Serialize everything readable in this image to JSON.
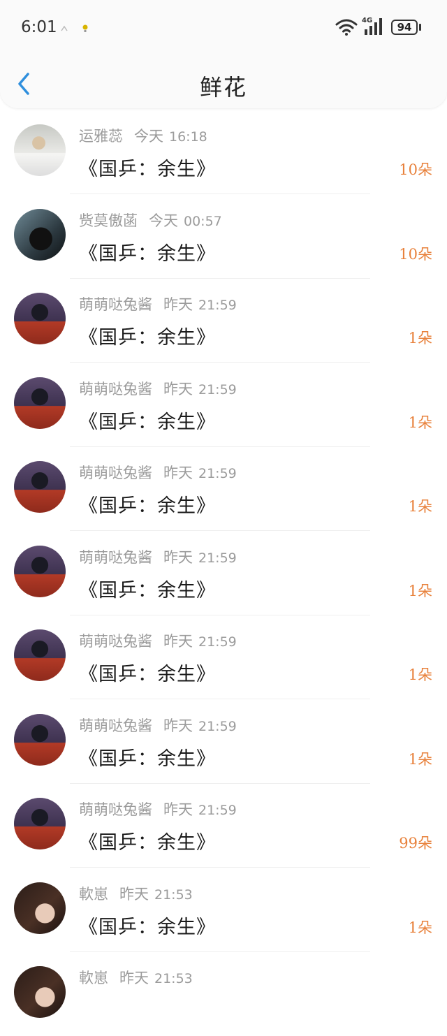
{
  "status": {
    "time": "6:01",
    "network": "4G",
    "battery": "94"
  },
  "header": {
    "title": "鲜花",
    "back_icon": "chevron-left-icon",
    "accent": "#2f8fdd"
  },
  "colors": {
    "count": "#e8813b",
    "meta": "#9b9b9b"
  },
  "items": [
    {
      "name": "运雅蕊",
      "date": "今天",
      "time": "16:18",
      "work": "《国乒：余生》",
      "count": "10朵",
      "avatar": "white"
    },
    {
      "name": "赀莫傲菡",
      "date": "今天",
      "time": "00:57",
      "work": "《国乒：余生》",
      "count": "10朵",
      "avatar": "dark"
    },
    {
      "name": "萌萌哒兔酱",
      "date": "昨天",
      "time": "21:59",
      "work": "《国乒：余生》",
      "count": "1朵",
      "avatar": "redgirl"
    },
    {
      "name": "萌萌哒兔酱",
      "date": "昨天",
      "time": "21:59",
      "work": "《国乒：余生》",
      "count": "1朵",
      "avatar": "redgirl"
    },
    {
      "name": "萌萌哒兔酱",
      "date": "昨天",
      "time": "21:59",
      "work": "《国乒：余生》",
      "count": "1朵",
      "avatar": "redgirl"
    },
    {
      "name": "萌萌哒兔酱",
      "date": "昨天",
      "time": "21:59",
      "work": "《国乒：余生》",
      "count": "1朵",
      "avatar": "redgirl"
    },
    {
      "name": "萌萌哒兔酱",
      "date": "昨天",
      "time": "21:59",
      "work": "《国乒：余生》",
      "count": "1朵",
      "avatar": "redgirl"
    },
    {
      "name": "萌萌哒兔酱",
      "date": "昨天",
      "time": "21:59",
      "work": "《国乒：余生》",
      "count": "1朵",
      "avatar": "redgirl"
    },
    {
      "name": "萌萌哒兔酱",
      "date": "昨天",
      "time": "21:59",
      "work": "《国乒：余生》",
      "count": "99朵",
      "avatar": "redgirl"
    },
    {
      "name": "軟崽",
      "date": "昨天",
      "time": "21:53",
      "work": "《国乒：余生》",
      "count": "1朵",
      "avatar": "brown"
    },
    {
      "name": "軟崽",
      "date": "昨天",
      "time": "21:53",
      "work": "",
      "count": "",
      "avatar": "brown"
    }
  ]
}
